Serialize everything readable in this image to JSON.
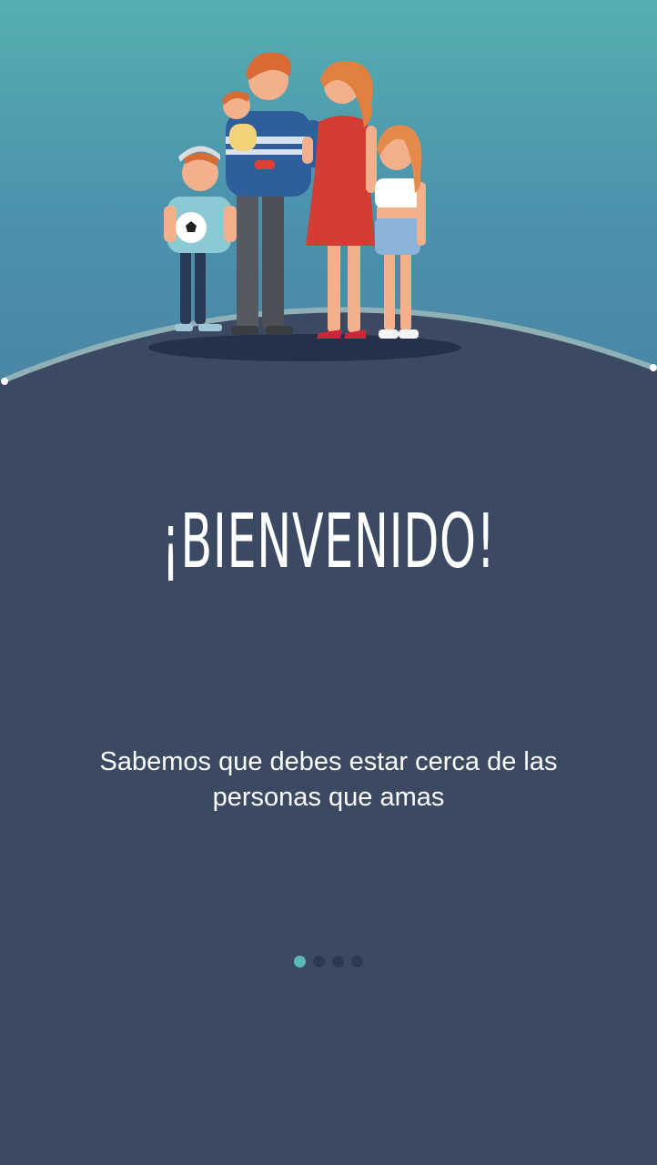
{
  "onboarding": {
    "title": "¡BIENVENIDO!",
    "subtitle": "Sabemos que debes estar cerca de las personas que amas",
    "pagination": {
      "total": 4,
      "active": 1
    }
  },
  "colors": {
    "gradient_top": "#55afb1",
    "gradient_bottom": "#4a86a7",
    "panel": "#3b4a62",
    "accent_dot": "#5ab9b4",
    "inactive_dot": "#2c3a4f",
    "text": "#ffffff"
  },
  "illustration": {
    "subject": "family-illustration"
  }
}
